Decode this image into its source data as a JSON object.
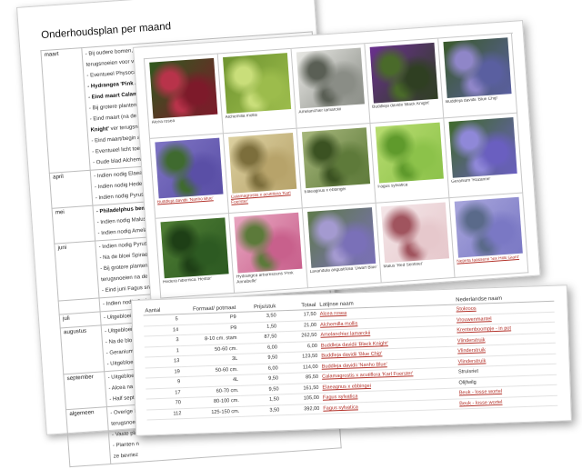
{
  "plan": {
    "title": "Onderhoudsplan per maand",
    "months": [
      {
        "month": "maart",
        "tasks": [
          {
            "bold": "",
            "text": "- Bij oudere bomen, indi"
          },
          {
            "bold": "",
            "text": "terugsnoeien voor veji"
          },
          {
            "bold": "",
            "text": "- Eventueel Physocarp"
          },
          {
            "bold": "- Hydrangea 'Pink Ann",
            "text": ""
          },
          {
            "bold": "- Eind maart Calamagr",
            "text": ""
          },
          {
            "bold": "",
            "text": "- Bij grotere planten Spi"
          },
          {
            "bold": "",
            "text": "- Eind maart (na de laat"
          },
          {
            "bold": "Knight'",
            "text": " ver terugsnoe"
          },
          {
            "bold": "",
            "text": "- Eind maart/begin april"
          },
          {
            "bold": "",
            "text": "- Eventueel licht toevoe"
          },
          {
            "bold": "",
            "text": "- Oude blad Alchemilla"
          }
        ]
      },
      {
        "month": "april",
        "tasks": [
          {
            "bold": "",
            "text": "- Indien nodig Elaeagn"
          },
          {
            "bold": "",
            "text": "- Indien nodig Hedera"
          },
          {
            "bold": "",
            "text": "- Indien nodig Pyrus ca"
          }
        ]
      },
      {
        "month": "mei",
        "tasks": [
          {
            "bold": "- Philadelphus bemest",
            "text": ""
          },
          {
            "bold": "",
            "text": "- Indien nodig Malus 'F"
          },
          {
            "bold": "",
            "text": "- Indien nodig Amelanc"
          }
        ]
      },
      {
        "month": "juni",
        "tasks": [
          {
            "bold": "",
            "text": "- Indien nodig Pyrus ca"
          },
          {
            "bold": "",
            "text": "- Na de bloei Spiraea"
          },
          {
            "bold": "",
            "text": "- Bij grotere planten Ph"
          },
          {
            "bold": "",
            "text": "terugsnoeien na de bl"
          },
          {
            "bold": "",
            "text": "- Eind juni Fagus snoei"
          }
        ]
      },
      {
        "month": "",
        "tasks": [
          {
            "bold": "",
            "text": "- Indien nodig Syringa"
          }
        ]
      },
      {
        "month": "juli",
        "tasks": [
          {
            "bold": "",
            "text": "- Uitgebloeide bloemen"
          }
        ]
      },
      {
        "month": "augustus",
        "tasks": [
          {
            "bold": "",
            "text": "- Uitgebloeide bloemen"
          },
          {
            "bold": "",
            "text": "- Na de bloei Buddleja"
          },
          {
            "bold": "",
            "text": "- Geranium 'Rozanne'"
          },
          {
            "bold": "",
            "text": "- Uitgebloeide bloemen"
          }
        ]
      },
      {
        "month": "september",
        "tasks": [
          {
            "bold": "",
            "text": "- Uitgebloeide bloemen"
          },
          {
            "bold": "",
            "text": "- Alcea na de bloei"
          },
          {
            "bold": "",
            "text": "- Half september"
          }
        ]
      },
      {
        "month": "algemeen",
        "tasks": [
          {
            "bold": "",
            "text": "- Overige bo"
          },
          {
            "bold": "",
            "text": "terugsnoei"
          },
          {
            "bold": "",
            "text": "- Vaste pla"
          },
          {
            "bold": "",
            "text": "- Planten n"
          },
          {
            "bold": "",
            "text": "ze bevriez"
          }
        ]
      }
    ]
  },
  "photos": [
    {
      "caption": "Alcea rosea",
      "link": false,
      "palette": [
        "#7d1a2a",
        "#2f5a1e",
        "#b8334a"
      ]
    },
    {
      "caption": "Alchemilla mollis",
      "link": false,
      "palette": [
        "#9cbc4c",
        "#6f9430",
        "#c9de7a"
      ]
    },
    {
      "caption": "Amelanchier lamarckii",
      "link": false,
      "palette": [
        "#8a8d86",
        "#e8e8e4",
        "#5a5f55"
      ]
    },
    {
      "caption": "Buddleja davidii 'Black Knight'",
      "link": false,
      "palette": [
        "#2f3f22",
        "#6a2f8f",
        "#4a6a2a"
      ]
    },
    {
      "caption": "Buddleja davidii 'Blue Chip'",
      "link": false,
      "palette": [
        "#5a5fa0",
        "#3a5a2a",
        "#8f86c8"
      ]
    },
    {
      "caption": "Buddleja davidii 'Nanho Blue'",
      "link": true,
      "palette": [
        "#5a4fa6",
        "#7e74c4",
        "#3f6a2f"
      ]
    },
    {
      "caption": "Calamagrostis x acutiflora 'Karl Foerster'",
      "link": true,
      "palette": [
        "#b7a36a",
        "#dcd0a0",
        "#7c6e3c"
      ]
    },
    {
      "caption": "Elaeagnus x ebbingei",
      "link": false,
      "palette": [
        "#5e7a3a",
        "#a7b77c",
        "#3b5222"
      ]
    },
    {
      "caption": "Fagus sylvatica",
      "link": false,
      "palette": [
        "#8cc24a",
        "#b8dc70",
        "#5f9a2c"
      ]
    },
    {
      "caption": "Geranium 'Rozanne'",
      "link": false,
      "palette": [
        "#6a5fc0",
        "#3f6a2a",
        "#8f88d8"
      ]
    },
    {
      "caption": "Hedera hibernica 'Hestor'",
      "link": false,
      "palette": [
        "#2d5a22",
        "#4f7e34",
        "#1e3f16"
      ]
    },
    {
      "caption": "Hydrangea arborescens 'Pink Annabelle'",
      "link": false,
      "palette": [
        "#c8608c",
        "#e8a6c0",
        "#5c7a3a"
      ]
    },
    {
      "caption": "Lavandula angustifolia 'Dwarf Blue'",
      "link": false,
      "palette": [
        "#7a70b8",
        "#5e7a4a",
        "#a49ad0"
      ]
    },
    {
      "caption": "Malus 'Red Sentinel'",
      "link": false,
      "palette": [
        "#e6c8cc",
        "#f4e6e8",
        "#a0545e"
      ]
    },
    {
      "caption": "Nepeta faassenii 'Six Hills Giant'",
      "link": true,
      "palette": [
        "#7a78c4",
        "#a8a6dc",
        "#5a6a8a"
      ]
    }
  ],
  "list": {
    "headers": {
      "aantal": "Aantal",
      "formaat": "Formaat/ potmaat",
      "prijs": "Prijs/stuk",
      "totaal": "Totaal",
      "latijn": "Latijnse naam",
      "nl": "Nederlandse naam"
    },
    "rows": [
      {
        "aantal": "5",
        "formaat": "P9",
        "prijs": "3,50",
        "totaal": "17,50",
        "latijn": "Alcea rosea",
        "latijn_link": true,
        "nl": "Stokroos",
        "nl_link": true
      },
      {
        "aantal": "14",
        "formaat": "P9",
        "prijs": "1,50",
        "totaal": "21,00",
        "latijn": "Alchemilla mollis",
        "latijn_link": true,
        "nl": "Vrouwenmantel",
        "nl_link": true
      },
      {
        "aantal": "3",
        "formaat": "8-10 cm. stam",
        "prijs": "87,50",
        "totaal": "262,50",
        "latijn": "Amelanchier lamarckii",
        "latijn_link": true,
        "nl": "Krentenboompje - in pot",
        "nl_link": true
      },
      {
        "aantal": "1",
        "formaat": "50-60 cm.",
        "prijs": "6,00",
        "totaal": "6,00",
        "latijn": "Buddleja davidii 'Black Knight'",
        "latijn_link": true,
        "nl": "Vlinderstruik",
        "nl_link": true
      },
      {
        "aantal": "13",
        "formaat": "3L",
        "prijs": "9,50",
        "totaal": "123,50",
        "latijn": "Buddleja davidii 'Blue Chip'",
        "latijn_link": true,
        "nl": "Vlinderstruik",
        "nl_link": true
      },
      {
        "aantal": "19",
        "formaat": "50-60 cm.",
        "prijs": "6,00",
        "totaal": "114,00",
        "latijn": "Buddleja davidii 'Nanho Blue'",
        "latijn_link": true,
        "nl": "Vlinderstruik",
        "nl_link": true
      },
      {
        "aantal": "9",
        "formaat": "4L",
        "prijs": "9,50",
        "totaal": "85,50",
        "latijn": "Calamagrostis x acutiflora 'Karl Foerster'",
        "latijn_link": true,
        "nl": "Struisriet",
        "nl_link": false
      },
      {
        "aantal": "17",
        "formaat": "60-70 cm.",
        "prijs": "9,50",
        "totaal": "161,50",
        "latijn": "Elaeagnus x ebbingei",
        "latijn_link": true,
        "nl": "Olijfwilg",
        "nl_link": false
      },
      {
        "aantal": "70",
        "formaat": "80-100 cm.",
        "prijs": "1,50",
        "totaal": "105,00",
        "latijn": "Fagus sylvatica",
        "latijn_link": true,
        "nl": "Beuk - losse wortel",
        "nl_link": true
      },
      {
        "aantal": "112",
        "formaat": "125-150 cm.",
        "prijs": "3,50",
        "totaal": "392,00",
        "latijn": "Fagus sylvatica",
        "latijn_link": true,
        "nl": "Beuk - losse wortel",
        "nl_link": true
      }
    ]
  }
}
